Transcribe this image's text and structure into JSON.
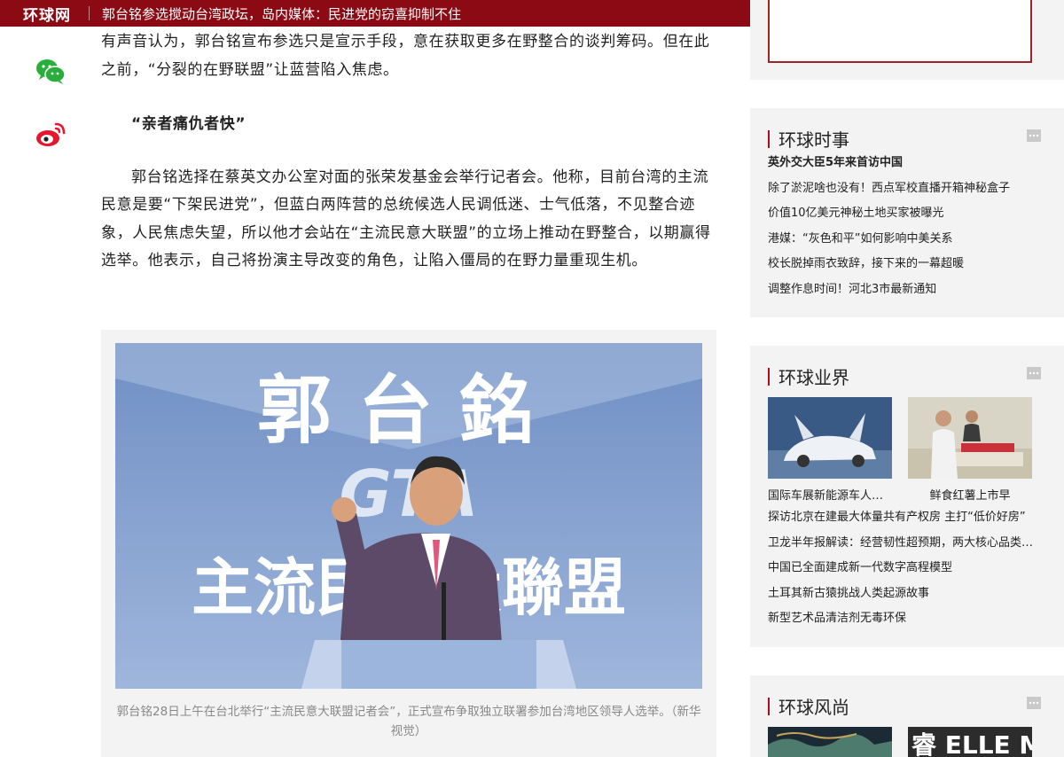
{
  "header": {
    "logo": "环球网",
    "title": "郭台铭参选搅动台湾政坛，岛内媒体：民进党的窃喜抑制不住",
    "search_icon": "search-icon",
    "menu_icon": "menu-icon",
    "bg_color": "#8c0a13"
  },
  "share": {
    "wechat_icon": "wechat-icon",
    "weibo_icon": "weibo-icon"
  },
  "article": {
    "para_top": "有声音认为，郭台铭宣布参选只是宣示手段，意在获取更多在野整合的谈判筹码。但在此之前，“分裂的在野联盟”让蓝营陷入焦虑。",
    "subhead": "“亲者痛仇者快”",
    "para_main": "郭台铭选择在蔡英文办公室对面的张荣发基金会举行记者会。他称，目前台湾的主流民意是要“下架民进党”，但蓝白两阵营的总统候选人民调低迷、士气低落，不见整合迹象，人民焦虑失望，所以他才会站在“主流民意大联盟”的立场上推动在野整合，以期赢得选举。他表示，自己将扮演主导改变的角色，让陷入僵局的在野力量重现生机。",
    "photo": {
      "sign_line1": "郭台銘",
      "sign_line2": "GTA",
      "sign_line3": "主流民意大聯盟",
      "caption": "郭台铭28日上午在台北举行“主流民意大联盟记者会”，正式宣布争取独立联署参加台湾地区领导人选举。（新华视觉）"
    }
  },
  "sidebar": {
    "shishi": {
      "title": "环球时事",
      "items": [
        "英外交大臣5年来首访中国",
        "除了淤泥啥也没有！西点军校直播开箱神秘盒子",
        "价值10亿美元神秘土地买家被曝光",
        "港媒：“灰色和平”如何影响中美关系",
        "校长脱掉雨衣致辞，接下来的一幕超暖",
        "调整作息时间！河北3市最新通知"
      ]
    },
    "yejie": {
      "title": "环球业界",
      "thumbs": [
        {
          "caption": "国际车展新能源车人气旺",
          "icon": "car-photo"
        },
        {
          "caption": "鲜食红薯上市早",
          "icon": "workers-photo"
        }
      ],
      "items": [
        "探访北京在建最大体量共有产权房 主打“低价好房”",
        "卫龙半年报解读：经营韧性超预期，两大核心品类增长",
        "中国已全面建成新一代数字高程模型",
        "土耳其新古猿挑战人类起源故事",
        "新型艺术品清洁剂无毒环保"
      ]
    },
    "fengshang": {
      "title": "环球风尚",
      "thumbs": [
        {
          "caption": "",
          "icon": "painting-photo"
        },
        {
          "caption": "",
          "icon": "magazine-photo",
          "text": "睿 ELLE MEN"
        }
      ]
    },
    "accent_color": "#b40c16"
  }
}
